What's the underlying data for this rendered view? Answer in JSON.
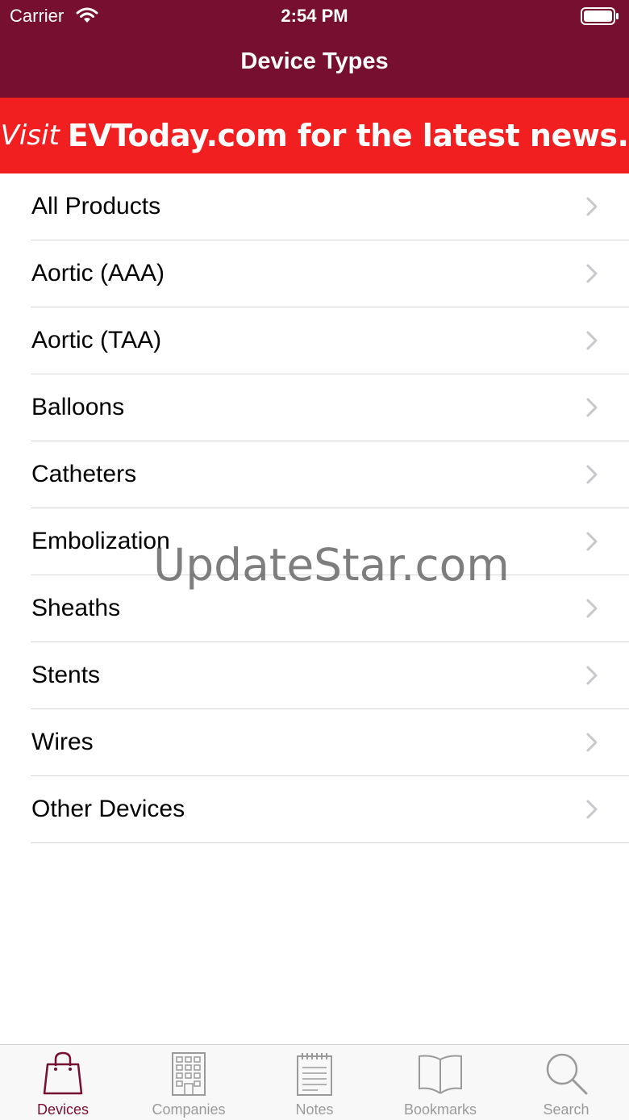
{
  "status_bar": {
    "carrier": "Carrier",
    "time": "2:54 PM"
  },
  "nav": {
    "title": "Device Types"
  },
  "banner": {
    "visit": "Visit",
    "text": "EVToday.com for the latest news."
  },
  "list": {
    "items": [
      {
        "label": "All Products"
      },
      {
        "label": "Aortic (AAA)"
      },
      {
        "label": "Aortic (TAA)"
      },
      {
        "label": "Balloons"
      },
      {
        "label": "Catheters"
      },
      {
        "label": "Embolization"
      },
      {
        "label": "Sheaths"
      },
      {
        "label": "Stents"
      },
      {
        "label": "Wires"
      },
      {
        "label": "Other Devices"
      }
    ]
  },
  "watermark": "UpdateStar.com",
  "tabbar": {
    "tabs": [
      {
        "label": "Devices",
        "icon": "bag-icon",
        "active": true
      },
      {
        "label": "Companies",
        "icon": "building-icon",
        "active": false
      },
      {
        "label": "Notes",
        "icon": "notepad-icon",
        "active": false
      },
      {
        "label": "Bookmarks",
        "icon": "book-icon",
        "active": false
      },
      {
        "label": "Search",
        "icon": "search-icon",
        "active": false
      }
    ]
  },
  "colors": {
    "nav_bg": "#760f30",
    "banner_bg": "#f21f21",
    "active_tab": "#760f30",
    "inactive_tab": "#9a9a9a"
  }
}
